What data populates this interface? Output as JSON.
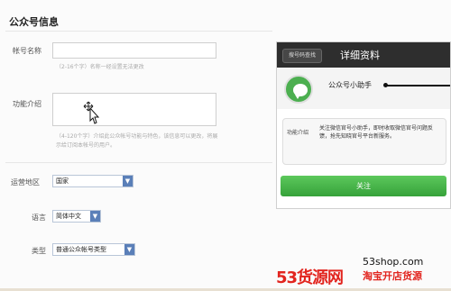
{
  "page": {
    "section_title": "公众号信息"
  },
  "form": {
    "account_name": {
      "label": "帐号名称",
      "hint": "（2-16个字）名称一经设置无法更改",
      "value": ""
    },
    "function": {
      "label": "功能介绍",
      "hint": "（4-120个字）介绍此公众帐号功能与特色，该信息可以更改，将展示给订阅本帐号的用户。",
      "value": ""
    },
    "region": {
      "label": "运营地区",
      "selected": "国家"
    },
    "language": {
      "label": "语言",
      "selected": "简体中文"
    },
    "type": {
      "label": "类型",
      "selected": "普通公众帐号类型"
    }
  },
  "phone": {
    "back_label": "搜号码查找",
    "title": "详细资料",
    "profile_name": "公众号小助手",
    "card_label": "功能介绍",
    "card_text": "关注微信官号小助手，即时收取微信官号问题反馈，抢先知晓官号平台新服务。",
    "follow_label": "关注"
  },
  "watermark": {
    "left": "53货源网",
    "site": "53shop.com",
    "right": "淘宝开店货源"
  },
  "colors": {
    "accent_green": "#36a23a",
    "select_arrow": "#5a7fb8",
    "watermark_red": "#e2251f"
  }
}
